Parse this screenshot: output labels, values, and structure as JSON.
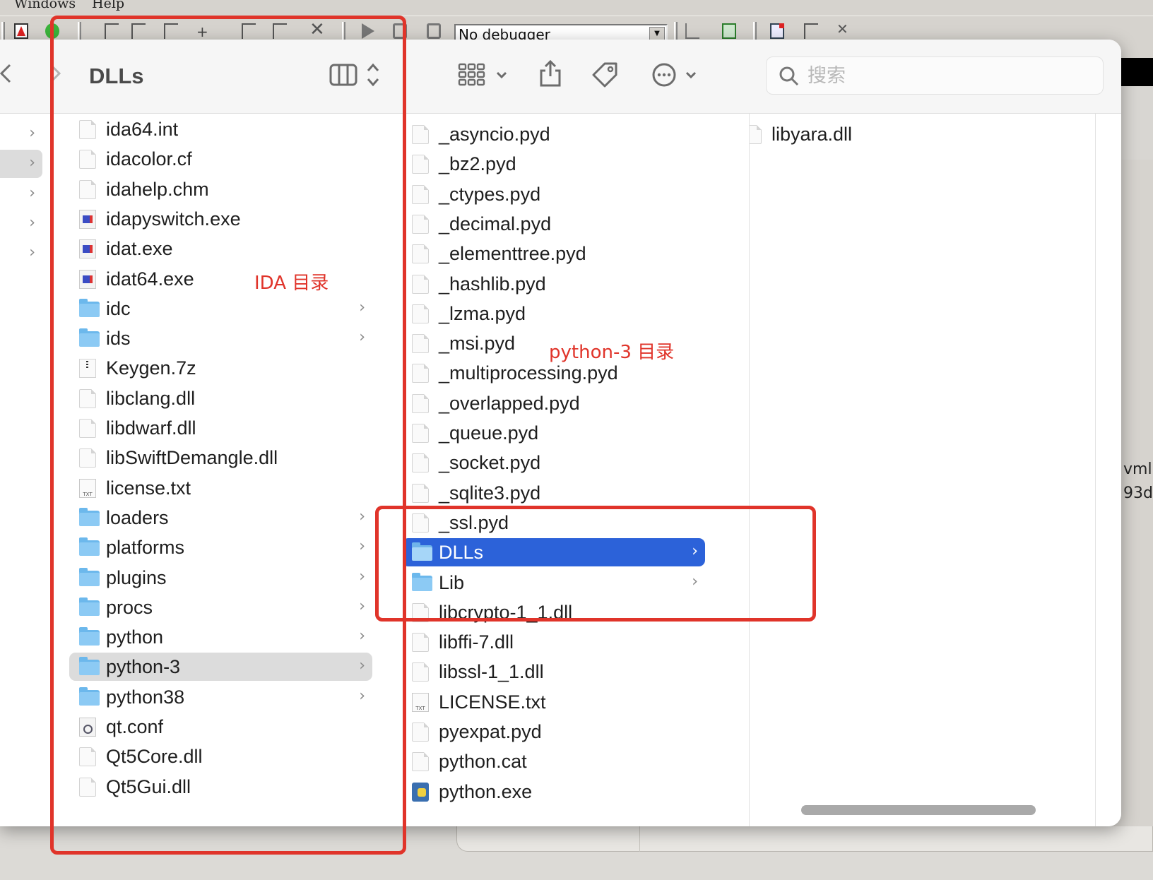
{
  "ida": {
    "menu": [
      "Windows",
      "Help"
    ],
    "debugger_select": "No debugger",
    "right_text": [
      "vml",
      "93d"
    ]
  },
  "finder": {
    "title": "DLLs",
    "search": {
      "placeholder": "搜索",
      "value": ""
    },
    "sidebar_rows": 5,
    "column1": [
      {
        "name": "ida64.int",
        "icon": "document-icon"
      },
      {
        "name": "idacolor.cf",
        "icon": "document-icon"
      },
      {
        "name": "idahelp.chm",
        "icon": "document-icon"
      },
      {
        "name": "idapyswitch.exe",
        "icon": "exe-icon"
      },
      {
        "name": "idat.exe",
        "icon": "exe-icon"
      },
      {
        "name": "idat64.exe",
        "icon": "exe-icon"
      },
      {
        "name": "idc",
        "icon": "folder-icon",
        "folder": true
      },
      {
        "name": "ids",
        "icon": "folder-icon",
        "folder": true
      },
      {
        "name": "Keygen.7z",
        "icon": "archive-icon"
      },
      {
        "name": "libclang.dll",
        "icon": "document-icon"
      },
      {
        "name": "libdwarf.dll",
        "icon": "document-icon"
      },
      {
        "name": "libSwiftDemangle.dll",
        "icon": "document-icon"
      },
      {
        "name": "license.txt",
        "icon": "text-file-icon"
      },
      {
        "name": "loaders",
        "icon": "folder-icon",
        "folder": true
      },
      {
        "name": "platforms",
        "icon": "folder-icon",
        "folder": true
      },
      {
        "name": "plugins",
        "icon": "folder-icon",
        "folder": true
      },
      {
        "name": "procs",
        "icon": "folder-icon",
        "folder": true
      },
      {
        "name": "python",
        "icon": "folder-icon",
        "folder": true
      },
      {
        "name": "python-3",
        "icon": "folder-icon",
        "folder": true,
        "selected": "grey"
      },
      {
        "name": "python38",
        "icon": "folder-icon",
        "folder": true
      },
      {
        "name": "qt.conf",
        "icon": "config-file-icon"
      },
      {
        "name": "Qt5Core.dll",
        "icon": "document-icon"
      },
      {
        "name": "Qt5Gui.dll",
        "icon": "document-icon"
      }
    ],
    "column2": [
      {
        "name": "_asyncio.pyd",
        "icon": "document-icon"
      },
      {
        "name": "_bz2.pyd",
        "icon": "document-icon"
      },
      {
        "name": "_ctypes.pyd",
        "icon": "document-icon"
      },
      {
        "name": "_decimal.pyd",
        "icon": "document-icon"
      },
      {
        "name": "_elementtree.pyd",
        "icon": "document-icon"
      },
      {
        "name": "_hashlib.pyd",
        "icon": "document-icon"
      },
      {
        "name": "_lzma.pyd",
        "icon": "document-icon"
      },
      {
        "name": "_msi.pyd",
        "icon": "document-icon"
      },
      {
        "name": "_multiprocessing.pyd",
        "icon": "document-icon"
      },
      {
        "name": "_overlapped.pyd",
        "icon": "document-icon"
      },
      {
        "name": "_queue.pyd",
        "icon": "document-icon"
      },
      {
        "name": "_socket.pyd",
        "icon": "document-icon"
      },
      {
        "name": "_sqlite3.pyd",
        "icon": "document-icon"
      },
      {
        "name": "_ssl.pyd",
        "icon": "document-icon"
      },
      {
        "name": "DLLs",
        "icon": "folder-icon",
        "folder": true,
        "selected": "blue"
      },
      {
        "name": "Lib",
        "icon": "folder-icon",
        "folder": true
      },
      {
        "name": "libcrypto-1_1.dll",
        "icon": "document-icon"
      },
      {
        "name": "libffi-7.dll",
        "icon": "document-icon"
      },
      {
        "name": "libssl-1_1.dll",
        "icon": "document-icon"
      },
      {
        "name": "LICENSE.txt",
        "icon": "text-file-icon"
      },
      {
        "name": "pyexpat.pyd",
        "icon": "document-icon"
      },
      {
        "name": "python.cat",
        "icon": "document-icon"
      },
      {
        "name": "python.exe",
        "icon": "python-exe-icon"
      }
    ],
    "column3": [
      {
        "name": "libyara.dll",
        "icon": "document-icon"
      }
    ]
  },
  "annotations": {
    "ida_dir": "IDA 目录",
    "python3_dir": "python-3 目录"
  },
  "colors": {
    "annotation_red": "#e0342a",
    "selection_blue": "#2c62d9",
    "selection_grey": "#dcdcdc"
  }
}
